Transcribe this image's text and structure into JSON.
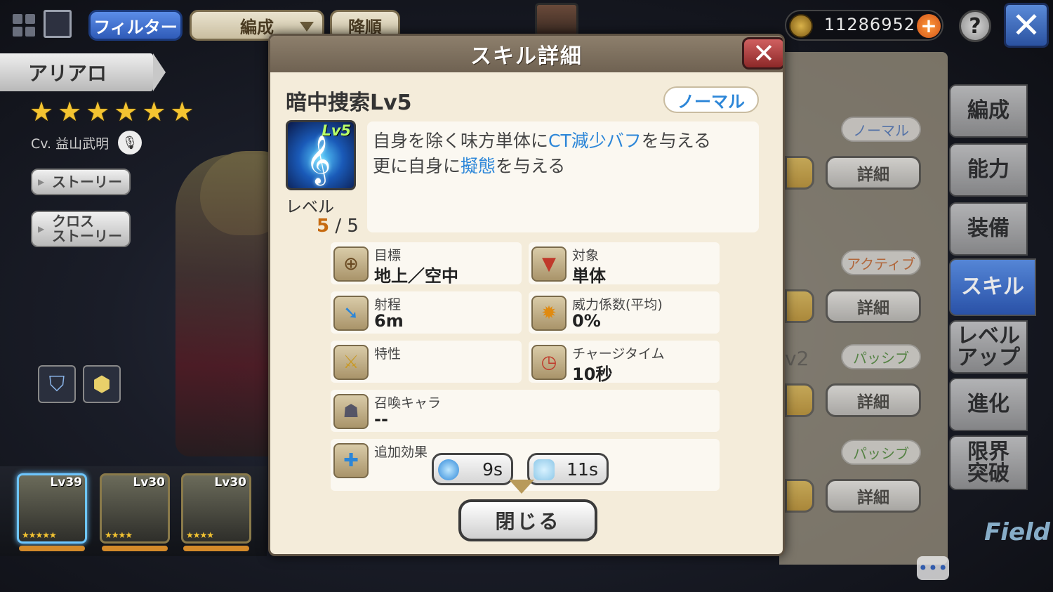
{
  "topbar": {
    "filter_label": "フィルター",
    "formation_label": "編成",
    "sort_label": "降順",
    "coins": "11286952"
  },
  "character": {
    "name": "アリアロ",
    "stars": [
      "★",
      "★",
      "★",
      "★",
      "★",
      "★"
    ],
    "cv": "Cv. 益山武明",
    "story_label": "ストーリー",
    "cross_story_label": "クロス\nストーリー"
  },
  "units": [
    {
      "level": "Lv39",
      "stars": "★★★★★"
    },
    {
      "level": "Lv30",
      "stars": "★★★★"
    },
    {
      "level": "Lv30",
      "stars": "★★★★"
    }
  ],
  "right_tabs": [
    "編成",
    "能力",
    "装備",
    "スキル",
    "レベル\nアップ",
    "進化",
    "限界\n突破"
  ],
  "underlying": {
    "pills": [
      "ノーマル",
      "アクティブ",
      "パッシブ",
      "パッシブ"
    ],
    "detail_label": "詳細",
    "lv2_text": "v2",
    "field_logo": "Field"
  },
  "dialog": {
    "title": "スキル詳細",
    "skill_name": "暗中捜索Lv5",
    "skill_type": "ノーマル",
    "icon_badge": "Lv5",
    "level_label": "レベル",
    "level_current": "5",
    "level_max": "/ 5",
    "desc_line1_a": "自身を除く味方単体に",
    "desc_line1_hl": "CT減少バフ",
    "desc_line1_b": "を与える",
    "desc_line2_a": "更に自身に",
    "desc_line2_hl": "擬態",
    "desc_line2_b": "を与える",
    "info": {
      "target_label": "目標",
      "target_value": "地上／空中",
      "subject_label": "対象",
      "subject_value": "単体",
      "range_label": "射程",
      "range_value": "6m",
      "power_label": "威力係数(平均)",
      "power_value": "0%",
      "trait_label": "特性",
      "trait_value": "",
      "charge_label": "チャージタイム",
      "charge_value": "10秒",
      "summon_label": "召喚キャラ",
      "summon_value": "--",
      "extra_label": "追加効果"
    },
    "effect1_duration": "9s",
    "effect2_duration": "11s",
    "close_label": "閉じる"
  },
  "colors": {
    "highlight": "#2c86d8",
    "level_current": "#c66a10",
    "close_red": "#8c2828"
  }
}
